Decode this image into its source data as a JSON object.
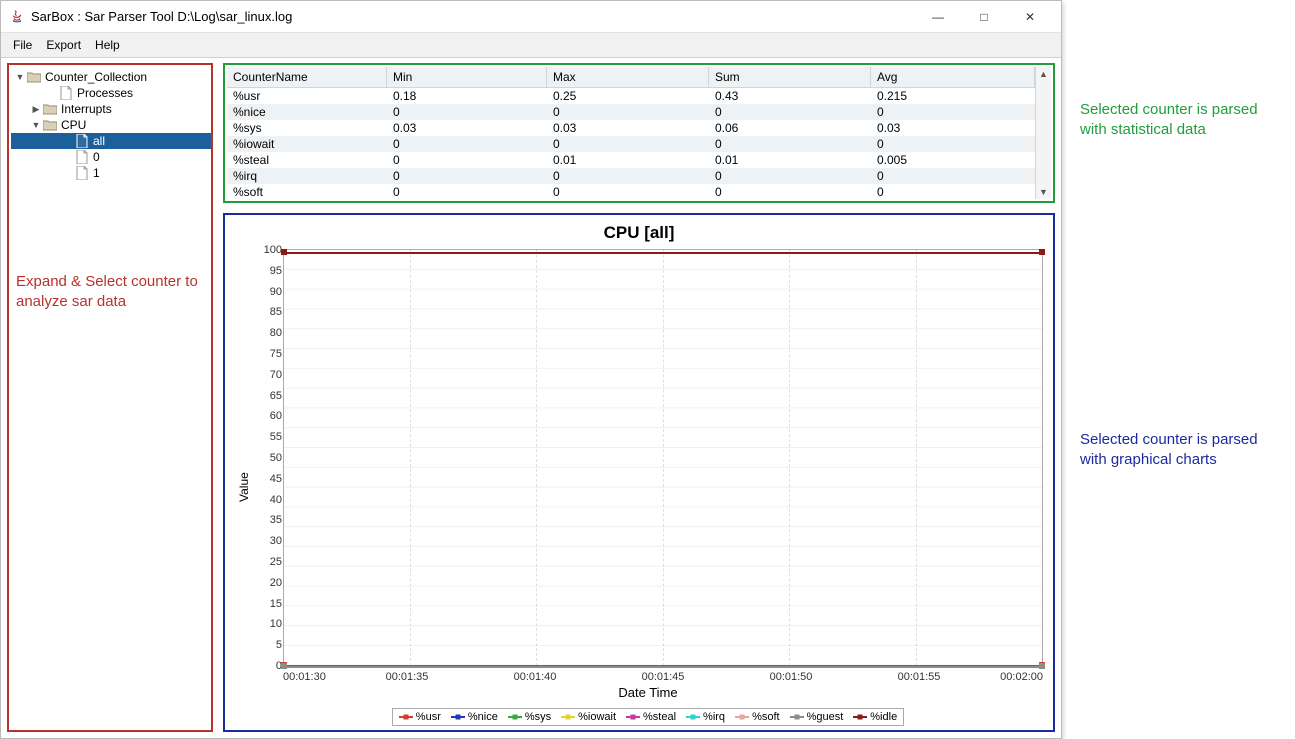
{
  "window": {
    "title": "SarBox : Sar Parser Tool D:\\Log\\sar_linux.log"
  },
  "menu": {
    "items": [
      "File",
      "Export",
      "Help"
    ]
  },
  "tree": {
    "root": "Counter_Collection",
    "nodes": [
      {
        "label": "Processes",
        "type": "file",
        "indent": 2
      },
      {
        "label": "Interrupts",
        "type": "folder",
        "indent": 1,
        "toggle": "▶"
      },
      {
        "label": "CPU",
        "type": "folder",
        "indent": 1,
        "toggle": "▼"
      },
      {
        "label": "all",
        "type": "file",
        "indent": 3,
        "selected": true
      },
      {
        "label": "0",
        "type": "file",
        "indent": 3
      },
      {
        "label": "1",
        "type": "file",
        "indent": 3
      }
    ]
  },
  "stats": {
    "columns": [
      "CounterName",
      "Min",
      "Max",
      "Sum",
      "Avg"
    ],
    "rows": [
      {
        "name": "%usr",
        "min": "0.18",
        "max": "0.25",
        "sum": "0.43",
        "avg": "0.215"
      },
      {
        "name": "%nice",
        "min": "0",
        "max": "0",
        "sum": "0",
        "avg": "0"
      },
      {
        "name": "%sys",
        "min": "0.03",
        "max": "0.03",
        "sum": "0.06",
        "avg": "0.03"
      },
      {
        "name": "%iowait",
        "min": "0",
        "max": "0",
        "sum": "0",
        "avg": "0"
      },
      {
        "name": "%steal",
        "min": "0",
        "max": "0.01",
        "sum": "0.01",
        "avg": "0.005"
      },
      {
        "name": "%irq",
        "min": "0",
        "max": "0",
        "sum": "0",
        "avg": "0"
      },
      {
        "name": "%soft",
        "min": "0",
        "max": "0",
        "sum": "0",
        "avg": "0"
      }
    ]
  },
  "chart_data": {
    "type": "line",
    "title": "CPU [all]",
    "xlabel": "Date Time",
    "ylabel": "Value",
    "ylim": [
      0,
      100
    ],
    "y_ticks": [
      100,
      95,
      90,
      85,
      80,
      75,
      70,
      65,
      60,
      55,
      50,
      45,
      40,
      35,
      30,
      25,
      20,
      15,
      10,
      5,
      0
    ],
    "x_ticks": [
      "00:01:30",
      "00:01:35",
      "00:01:40",
      "00:01:45",
      "00:01:50",
      "00:01:55",
      "00:02:00"
    ],
    "x": [
      "00:01:30",
      "00:02:00"
    ],
    "series": [
      {
        "name": "%usr",
        "color": "#d23b2e",
        "values": [
          0.2,
          0.2
        ]
      },
      {
        "name": "%nice",
        "color": "#2638b8",
        "values": [
          0,
          0
        ]
      },
      {
        "name": "%sys",
        "color": "#38a742",
        "values": [
          0.03,
          0.03
        ]
      },
      {
        "name": "%iowait",
        "color": "#e4d331",
        "values": [
          0,
          0
        ]
      },
      {
        "name": "%steal",
        "color": "#c43aa2",
        "values": [
          0,
          0.01
        ]
      },
      {
        "name": "%irq",
        "color": "#2ed0d0",
        "values": [
          0,
          0
        ]
      },
      {
        "name": "%soft",
        "color": "#e7a6a0",
        "values": [
          0,
          0
        ]
      },
      {
        "name": "%guest",
        "color": "#8c8c8c",
        "values": [
          0,
          0
        ]
      },
      {
        "name": "%idle",
        "color": "#8b1a1a",
        "values": [
          99.6,
          99.6
        ]
      }
    ]
  },
  "annotations": {
    "tree": "Expand & Select counter to analyze sar data",
    "stats": "Selected counter is parsed with statistical data",
    "chart": "Selected counter is parsed with graphical charts"
  }
}
